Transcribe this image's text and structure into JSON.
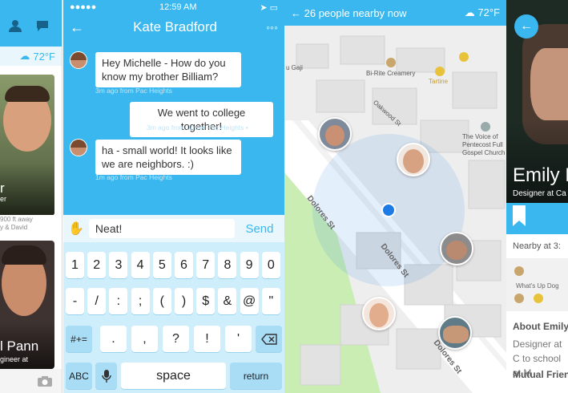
{
  "panel_list": {
    "weather": "72°F",
    "cards": [
      {
        "name_partial": "r",
        "sub_partial": "er",
        "distance_partial": "900 ft away",
        "mutual_partial": "y & David"
      },
      {
        "name_partial": "l Pann",
        "sub_partial": "gineer at"
      }
    ]
  },
  "panel_chat": {
    "status": {
      "time": "12:59 AM"
    },
    "title": "Kate Bradford",
    "messages": [
      {
        "text": "Hey Michelle - How do you know my brother Billiam?",
        "meta": "3m ago from Pac Heights"
      },
      {
        "text": "We went to college together!",
        "meta": "3m ago from Lower Pac Heights •",
        "read": "Read"
      },
      {
        "text": "ha - small world! It looks like we are neighbors.  :)",
        "meta": "1m ago from Pac Heights"
      }
    ],
    "input_value": "Neat!",
    "send_label": "Send",
    "keyboard": {
      "row1": [
        "1",
        "2",
        "3",
        "4",
        "5",
        "6",
        "7",
        "8",
        "9",
        "0"
      ],
      "row2": [
        "-",
        "/",
        ":",
        ";",
        "(",
        ")",
        "$",
        "&",
        "@",
        "\""
      ],
      "row3_left": "#+=",
      "row3": [
        ".",
        ",",
        "?",
        "!",
        "'"
      ],
      "abc": "ABC",
      "space": "space",
      "return": "return"
    }
  },
  "panel_map": {
    "header": "26 people nearby now",
    "weather": "72°F",
    "labels": {
      "gaji": "u Gaji",
      "birite": "Bi-Rite Creamery",
      "tartine": "Tartine",
      "oakwood": "Oakwood St",
      "church": "The Voice of Pentecost Full Gospel Church",
      "dolores1": "Dolores St",
      "dolores2": "Dolores St",
      "dolores3": "Dolores St"
    }
  },
  "panel_profile": {
    "name_partial": "Emily M",
    "sub_partial": "Designer at Ca",
    "nearby": "Nearby at 3:",
    "place": "What's Up Dog",
    "about_title": "About Emily",
    "about_text": "Designer at C to school at M",
    "mutual": "Mutual Frien"
  },
  "colors": {
    "accent": "#3ab7ee",
    "dot": "#1e7be6"
  }
}
